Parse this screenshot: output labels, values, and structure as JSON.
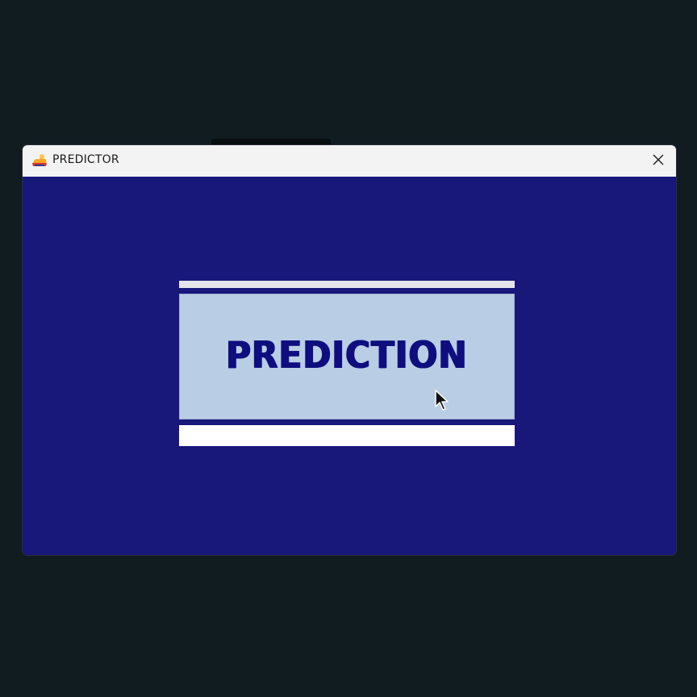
{
  "window": {
    "title": "PREDICTOR"
  },
  "main": {
    "predict_button_label": "PREDICTION",
    "result_value": ""
  },
  "icons": {
    "app": "predictor-app-icon",
    "close": "close-icon",
    "cursor": "mouse-pointer-icon"
  },
  "colors": {
    "client_background": "#18177a",
    "button_background": "#b9cde4",
    "button_text": "#0f0e7e",
    "titlebar": "#f3f3f3"
  }
}
